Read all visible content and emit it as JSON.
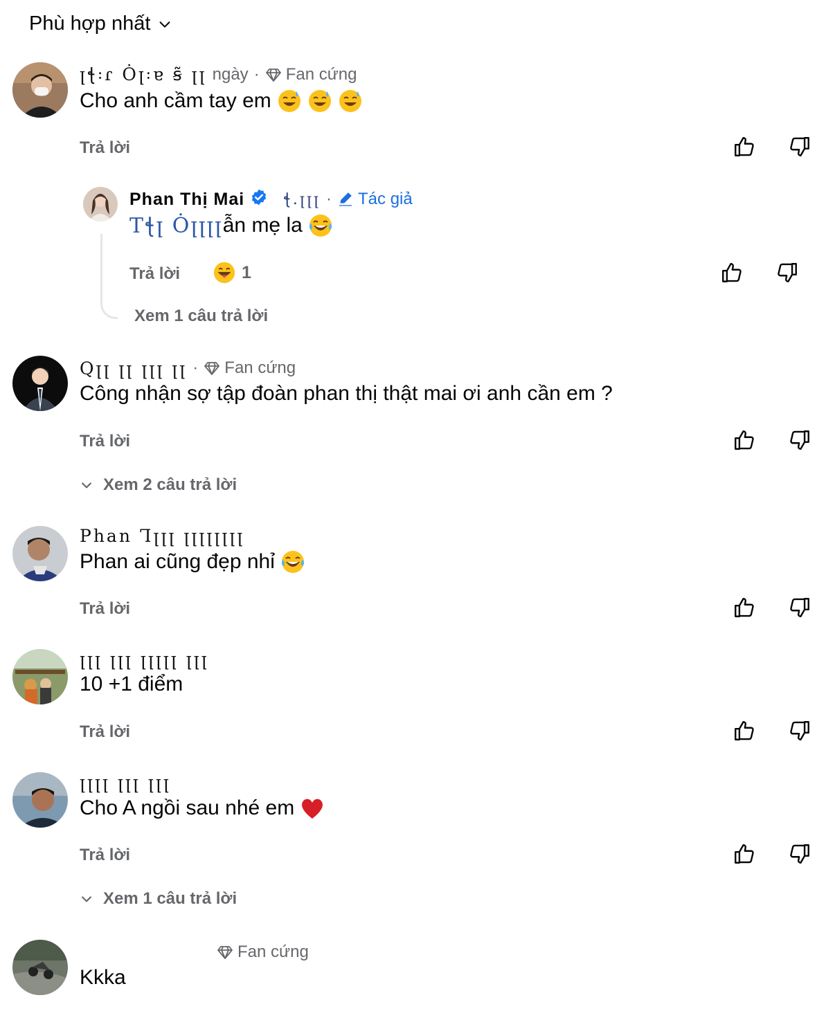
{
  "sort": {
    "label": "Phù hợp nhất"
  },
  "comments": [
    {
      "name": "ꞁꞎ꞉ɾ Ȯꞁ꞉ɐ ꞩ̃ ꞁꞁ",
      "time": "ngày",
      "badge": "Fan cứng",
      "text": "Cho anh cầm tay em",
      "reply": "Trả lời",
      "emojis": [
        "sweat-smile-emoji",
        "sweat-smile-emoji",
        "sweat-smile-emoji"
      ]
    },
    {
      "name": "Phan Thị Mai",
      "time": "ꞎ.ꞁꞁꞁ",
      "badge": "Tác giả",
      "mention": "Tꞎꞁ Ȯꞁꞁꞁꞁ",
      "text_rest": "ẫn mẹ la",
      "reply": "Trả lời",
      "reaction_count": "1",
      "view_replies": "Xem 1 câu trả lời"
    },
    {
      "name": "Qꞁꞁ ꞁꞁ ꞁꞁꞁ ꞁꞁ",
      "badge": "Fan cứng",
      "text": "Công nhận sợ tập đoàn phan thị thật mai ơi anh cần em ?",
      "reply": "Trả lời",
      "view_replies": "Xem 2 câu trả lời"
    },
    {
      "name": "Phan Ꞁꞁꞁꞁ ꞁꞁꞁꞁꞁꞁꞁꞁ",
      "text": "Phan ai cũng đẹp nhỉ",
      "reply": "Trả lời"
    },
    {
      "name": "ꞁꞁꞁ ꞁꞁꞁ ꞁꞁꞁꞁꞁ ꞁꞁꞁ",
      "text": "10 +1 điểm",
      "reply": "Trả lời"
    },
    {
      "name": "ꞁꞁꞁꞁ ꞁꞁꞁ ꞁꞁꞁ",
      "text": "Cho A ngồi sau nhé em",
      "reply": "Trả lời",
      "view_replies": "Xem 1 câu trả lời"
    },
    {
      "name": "",
      "badge": "Fan cứng",
      "text": "Kkka"
    }
  ],
  "colors": {
    "secondary_text": "#65676b",
    "author_blue": "#1b6fe0",
    "verified_blue": "#1877f2"
  }
}
